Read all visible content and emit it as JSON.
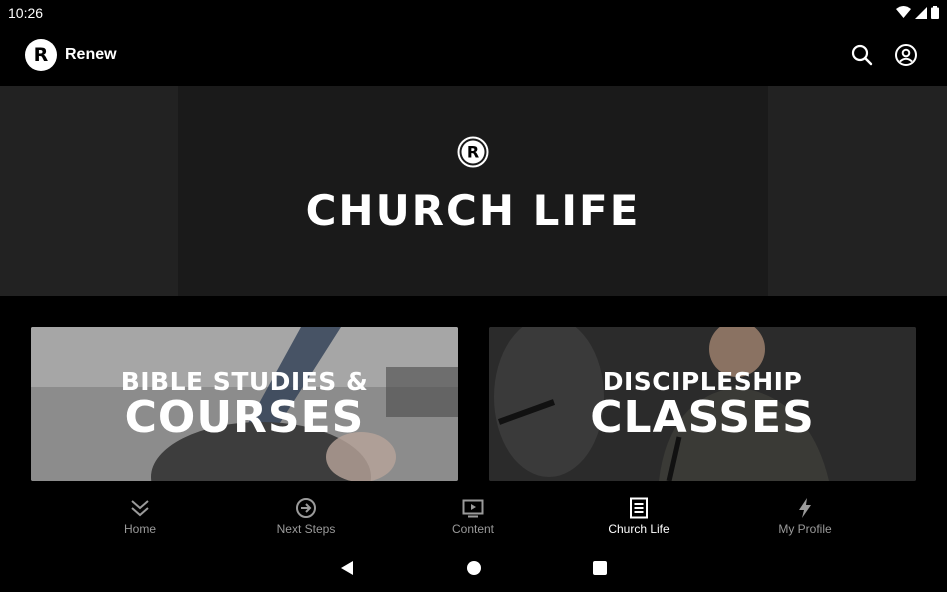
{
  "status_bar": {
    "time": "10:26"
  },
  "app_bar": {
    "logo_letter": "R",
    "title": "Renew"
  },
  "hero": {
    "logo_letter": "R",
    "title": "CHURCH LIFE"
  },
  "cards": [
    {
      "line1": "BIBLE STUDIES &",
      "line2": "COURSES"
    },
    {
      "line1": "DISCIPLESHIP",
      "line2": "CLASSES"
    }
  ],
  "bottom_nav": {
    "items": [
      {
        "label": "Home",
        "icon": "double-chevron-down-icon"
      },
      {
        "label": "Next Steps",
        "icon": "arrow-circle-icon"
      },
      {
        "label": "Content",
        "icon": "tv-play-icon"
      },
      {
        "label": "Church Life",
        "icon": "document-icon"
      },
      {
        "label": "My Profile",
        "icon": "lightning-icon"
      }
    ],
    "active": "Church Life"
  },
  "colors": {
    "background": "#000000",
    "hero_bg": "#1a1a1a",
    "hero_side": "#222222",
    "inactive_label": "#9a9a9a",
    "active_label": "#ffffff"
  }
}
